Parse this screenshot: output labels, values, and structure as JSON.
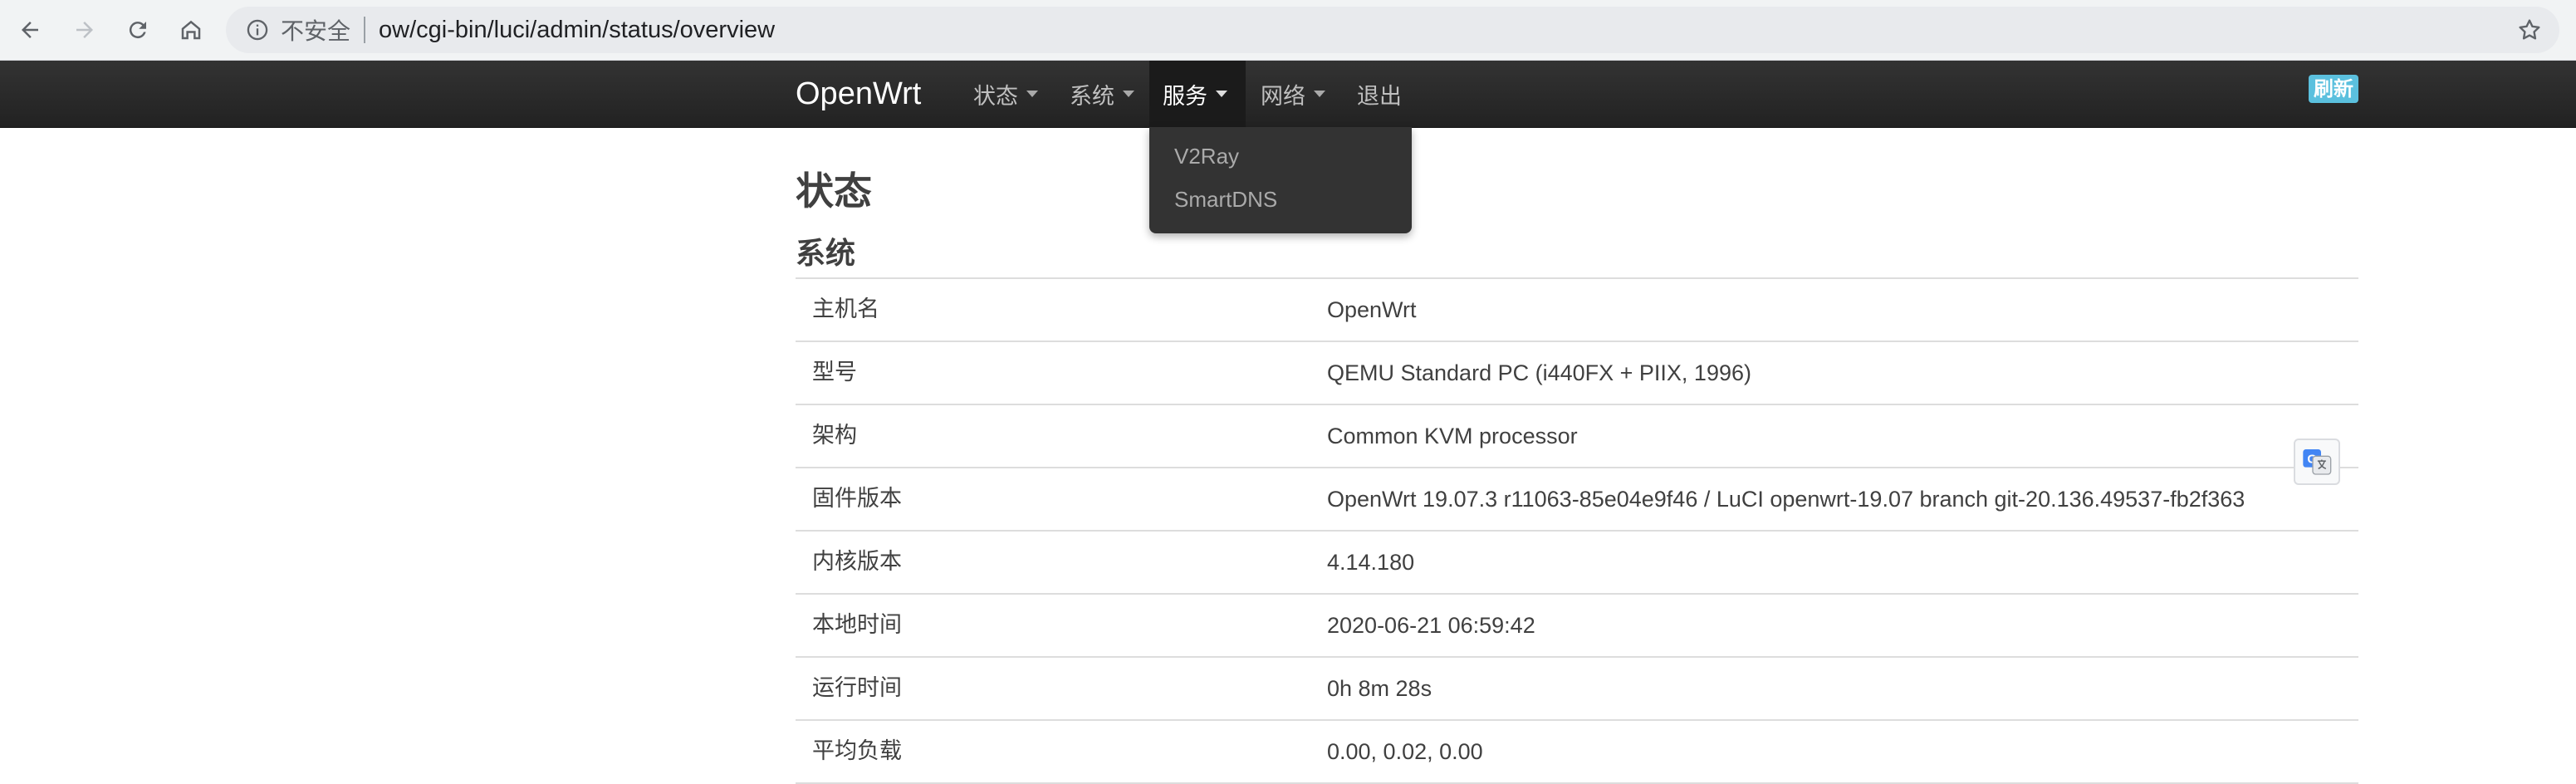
{
  "browser": {
    "security_label": "不安全",
    "url": "ow/cgi-bin/luci/admin/status/overview"
  },
  "navbar": {
    "brand": "OpenWrt",
    "menu": [
      {
        "label": "状态"
      },
      {
        "label": "系统"
      },
      {
        "label": "服务"
      },
      {
        "label": "网络"
      },
      {
        "label": "退出"
      }
    ],
    "refresh_label": "刷新"
  },
  "dropdown": {
    "items": [
      {
        "label": "V2Ray"
      },
      {
        "label": "SmartDNS"
      }
    ]
  },
  "page": {
    "title": "状态",
    "section_title": "系统"
  },
  "system_table": {
    "rows": [
      {
        "key": "主机名",
        "value": "OpenWrt"
      },
      {
        "key": "型号",
        "value": "QEMU Standard PC (i440FX + PIIX, 1996)"
      },
      {
        "key": "架构",
        "value": "Common KVM processor"
      },
      {
        "key": "固件版本",
        "value": "OpenWrt 19.07.3 r11063-85e04e9f46 / LuCI openwrt-19.07 branch git-20.136.49537-fb2f363"
      },
      {
        "key": "内核版本",
        "value": "4.14.180"
      },
      {
        "key": "本地时间",
        "value": "2020-06-21 06:59:42"
      },
      {
        "key": "运行时间",
        "value": "0h 8m 28s"
      },
      {
        "key": "平均负载",
        "value": "0.00, 0.02, 0.00"
      }
    ]
  },
  "colors": {
    "navbar_bg": "#222222",
    "active_menu_bg": "#1b1b1b",
    "refresh_badge": "#5bc0de",
    "text": "#404040"
  }
}
